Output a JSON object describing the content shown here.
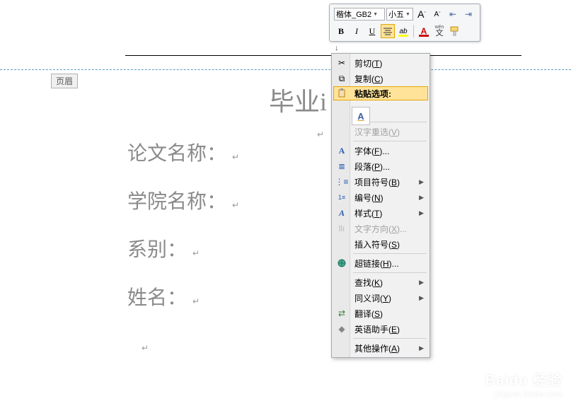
{
  "toolbar": {
    "font_name": "楷体_GB2",
    "font_size": "小五",
    "grow_font": "A",
    "shrink_font": "A",
    "bold": "B",
    "italic": "I",
    "underline": "U",
    "font_color_letter": "A",
    "pinyin_label": "wén",
    "pinyin_char": "文"
  },
  "header": {
    "label": "页眉"
  },
  "doc": {
    "title": "毕业i",
    "line1": "论文名称：",
    "line2": "学院名称：",
    "line3": "系别：",
    "line4": "姓名：",
    "para_mark": "↵"
  },
  "menu": {
    "cut": "剪切(T)",
    "copy": "复制(C)",
    "paste_options": "粘贴选项:",
    "paste_keep_text": "A",
    "reconvert": "汉字重选(V)",
    "font": "字体(F)...",
    "paragraph": "段落(P)...",
    "bullets": "项目符号(B)",
    "numbering": "编号(N)",
    "styles": "样式(T)",
    "text_direction": "文字方向(X)...",
    "insert_symbol": "插入符号(S)",
    "hyperlink": "超链接(H)...",
    "find": "查找(K)",
    "synonyms": "同义词(Y)",
    "translate": "翻译(S)",
    "english_assistant": "英语助手(E)",
    "other_actions": "其他操作(A)"
  },
  "watermark": {
    "brand": "Baidu 经验",
    "url": "jingyan.baidu.com"
  }
}
